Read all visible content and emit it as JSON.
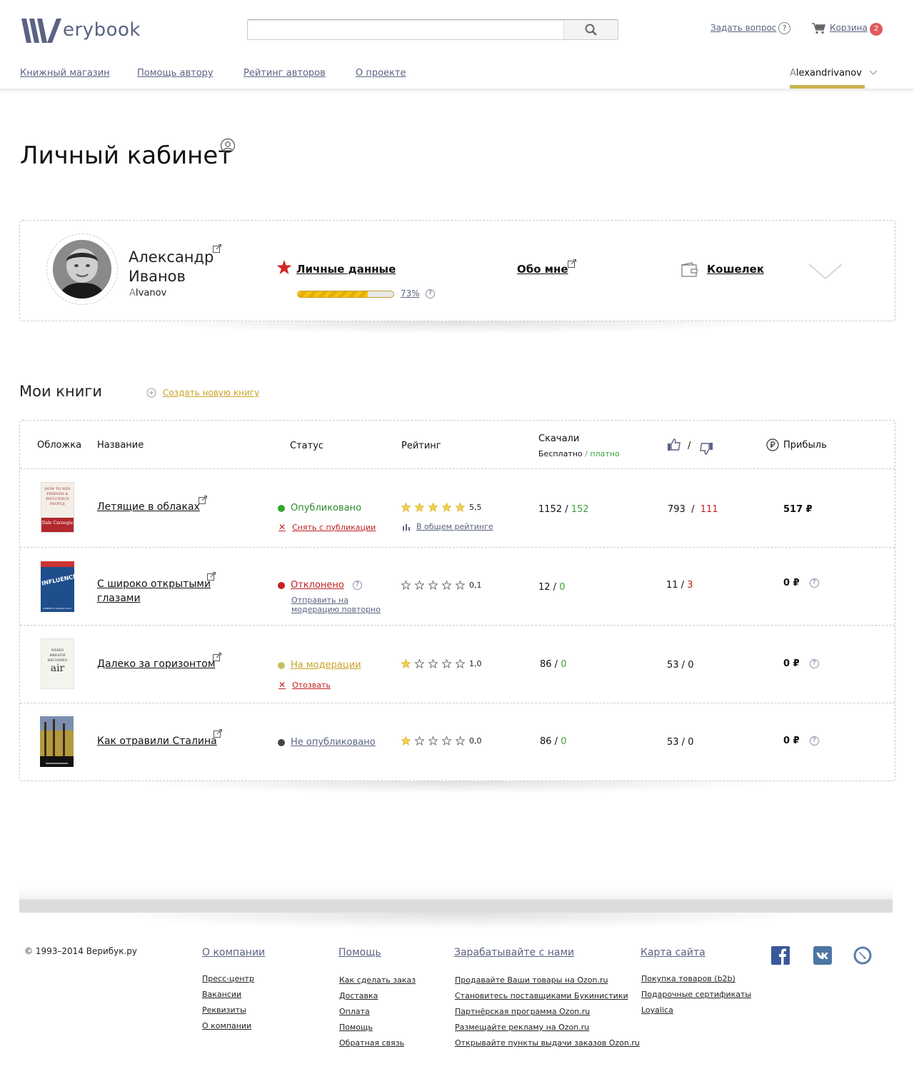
{
  "header": {
    "logo_text": "erybook",
    "search_placeholder": "",
    "ask_label": "Задать вопрос",
    "ask_icon_glyph": "?",
    "cart_label": "Корзина",
    "cart_count": "2",
    "nav": [
      "Книжный магазин",
      "Помощь автору",
      "Рейтинг авторов",
      "О проекте"
    ],
    "user_first_letter": "A",
    "user_rest": "lexandrivanov",
    "accent_color": "#c9b24f",
    "link_color": "#5a6382"
  },
  "page": {
    "title": "Личный кабинет"
  },
  "profile": {
    "name_line1": "Александр",
    "name_line2": "Иванов",
    "username_first": "A",
    "username_rest": "Ivanov",
    "personal_data_label": "Личные данные",
    "progress_value": 0.73,
    "progress_text": "73%",
    "about_label": "Обо мне",
    "wallet_label": "Кошелек"
  },
  "books": {
    "title": "Мои книги",
    "create_label": "Создать новую книгу",
    "columns": {
      "cover": "Обложка",
      "name": "Название",
      "status": "Статус",
      "rating": "Рейтинг",
      "downloads": "Скачали",
      "downloads_free": "Бесплатно",
      "downloads_sep": "/",
      "downloads_paid": "платно",
      "votes_sep": "/",
      "profit": "Прибыль"
    },
    "rows": [
      {
        "title": "Летящие в облаках",
        "status": "Опубликовано",
        "status_color": "#2ea82e",
        "action": "Снять с публикации",
        "rating_stars": 5,
        "rating_value": "5,5",
        "rating_link": "В общем рейтинге",
        "free": "1152",
        "paid": "152",
        "likes": "793",
        "dislikes": "111",
        "profit": "517",
        "currency": "₽",
        "cover_text": "HOW TO WIN FRIENDS & INFLUENCE PEOPLE",
        "cover_author": "Dale Carnegie"
      },
      {
        "title": "С широко открытыми глазами",
        "status": "Отклонено",
        "status_color": "#c81e1e",
        "action": "Отправить на модерацию повторно",
        "rating_stars": 0,
        "rating_value": "0,1",
        "free": "12",
        "paid": "0",
        "likes": "11",
        "dislikes": "3",
        "profit": "0",
        "currency": "₽",
        "cover_text": "INFLUENCE",
        "cover_author": "ROBERT B. CIALDINI, PH.D."
      },
      {
        "title": "Далеко за горизонтом",
        "status": "На модерации",
        "status_color": "#c8c060",
        "action": "Отозвать",
        "rating_stars": 1,
        "rating_value": "1,0",
        "free": "86",
        "paid": "0",
        "likes": "53",
        "dislikes": "0",
        "profit": "0",
        "currency": "₽",
        "cover_text": "WHEN BREATH BECOMES",
        "cover_author": "air"
      },
      {
        "title": "Как отравили Сталина",
        "status": "Не опубликовано",
        "status_color": "#444444",
        "rating_stars": 1,
        "rating_value": "0,0",
        "free": "86",
        "paid": "0",
        "likes": "53",
        "dislikes": "0",
        "profit": "0",
        "currency": "₽"
      }
    ]
  },
  "footer": {
    "copyright": "© 1993–2014 Верибук.ру",
    "columns": [
      {
        "title": "О компании",
        "links": [
          "Пресс-центр",
          "Вакансии",
          "Реквизиты",
          "О компании"
        ]
      },
      {
        "title": "Помощь",
        "links": [
          "Как сделать заказ",
          "Доставка",
          "Оплата",
          "Помощь",
          "Обратная связь"
        ]
      },
      {
        "title": "Зарабатывайте с нами",
        "links": [
          "Продавайте Ваши товары на Ozon.ru",
          "Становитесь поставщиками Букинистики",
          "Партнёрская программа Ozon.ru",
          "Размещайте рекламу на Ozon.ru",
          "Открывайте пункты выдачи заказов Ozon.ru"
        ]
      },
      {
        "title": "Карта сайта",
        "links": [
          "Покупка товаров (b2b)",
          "Подарочные сертификаты",
          "Loyalica"
        ]
      }
    ],
    "social": [
      "facebook-icon",
      "vk-icon",
      "livejournal-icon"
    ]
  }
}
